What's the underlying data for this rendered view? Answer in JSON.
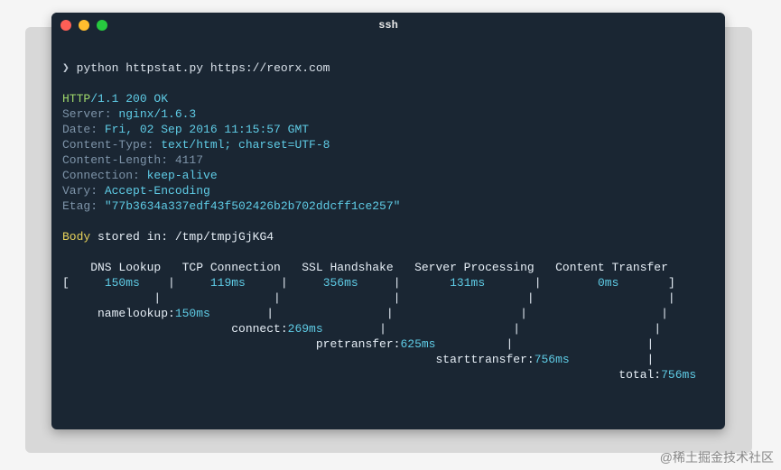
{
  "window": {
    "title": "ssh"
  },
  "prompt": {
    "symbol": "❯",
    "command": "python httpstat.py https://reorx.com"
  },
  "response": {
    "proto": "HTTP",
    "version": "/1.1 200 OK",
    "headers": {
      "server_label": "Server: ",
      "server_value": "nginx/1.6.3",
      "date_label": "Date: ",
      "date_value": "Fri, 02 Sep 2016 11:15:57 GMT",
      "ctype_label": "Content-Type: ",
      "ctype_value": "text/html; charset=UTF-8",
      "clen": "Content-Length: 4117",
      "conn_label": "Connection: ",
      "conn_value": "keep-alive",
      "vary_label": "Vary: ",
      "vary_value": "Accept-Encoding",
      "etag_label": "Etag: ",
      "etag_value": "\"77b3634a337edf43f502426b2b702ddcff1ce257\""
    }
  },
  "body": {
    "label": "Body",
    "text": " stored in: /tmp/tmpjGjKG4"
  },
  "timing": {
    "header": "    DNS Lookup   TCP Connection   SSL Handshake   Server Processing   Content Transfer",
    "row_open": "[     ",
    "dns": "150ms",
    "sep1": "    |     ",
    "tcp": "119ms",
    "sep2": "     |     ",
    "ssl": "356ms",
    "sep3": "     |       ",
    "server": "131ms",
    "sep4": "       |        ",
    "transfer": "0ms",
    "row_close": "       ]",
    "bars1": "             |                |                |                  |                   |",
    "namelookup_lbl": "     namelookup:",
    "namelookup_val": "150ms",
    "namelookup_rest": "        |                |                  |                   |",
    "connect_lbl": "                        connect:",
    "connect_val": "269ms",
    "connect_rest": "        |                  |                   |",
    "pretransfer_lbl": "                                    pretransfer:",
    "pretransfer_val": "625ms",
    "pretransfer_rest": "          |                   |",
    "starttransfer_lbl": "                                                     starttransfer:",
    "starttransfer_val": "756ms",
    "starttransfer_rest": "           |",
    "total_lbl": "                                                                               total:",
    "total_val": "756ms"
  },
  "watermark": "@稀土掘金技术社区"
}
